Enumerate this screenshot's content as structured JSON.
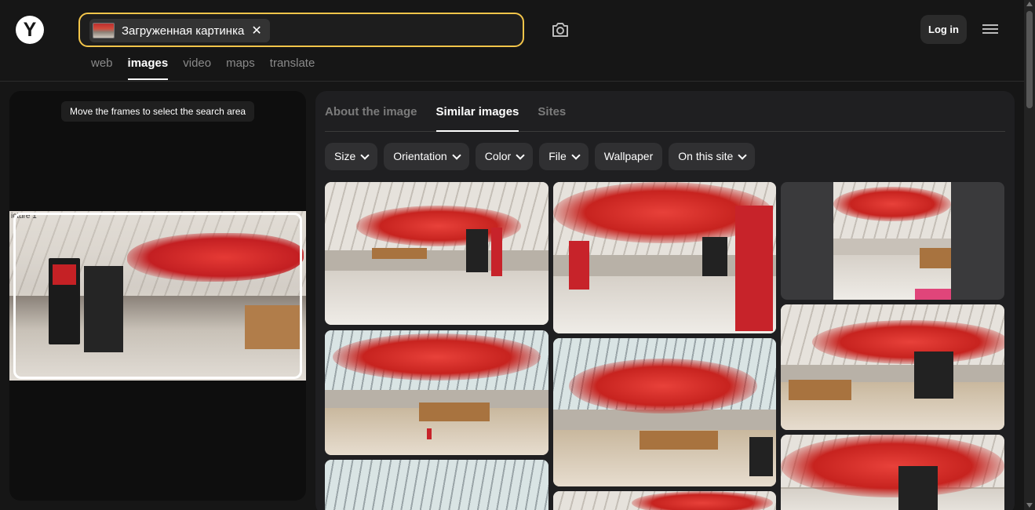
{
  "header": {
    "logo_letter": "Y",
    "search": {
      "chip_label": "Загруженная картинка",
      "close_glyph": "✕"
    },
    "camera_icon": "camera-search-icon",
    "login_label": "Log in",
    "menu_icon": "hamburger-menu-icon",
    "nav": [
      {
        "label": "web",
        "active": false
      },
      {
        "label": "images",
        "active": true
      },
      {
        "label": "video",
        "active": false
      },
      {
        "label": "maps",
        "active": false
      },
      {
        "label": "translate",
        "active": false
      }
    ]
  },
  "left_panel": {
    "hint": "Move the frames to select the search area",
    "image_label": "icture 1"
  },
  "right_panel": {
    "tabs": [
      {
        "label": "About the image",
        "active": false
      },
      {
        "label": "Similar images",
        "active": true
      },
      {
        "label": "Sites",
        "active": false
      }
    ],
    "filters": [
      {
        "label": "Size",
        "has_dropdown": true
      },
      {
        "label": "Orientation",
        "has_dropdown": true
      },
      {
        "label": "Color",
        "has_dropdown": true
      },
      {
        "label": "File",
        "has_dropdown": true
      },
      {
        "label": "Wallpaper",
        "has_dropdown": false
      },
      {
        "label": "On this site",
        "has_dropdown": true
      }
    ],
    "results_count_visible": 9
  },
  "colors": {
    "background": "#161616",
    "panel": "#1f1f21",
    "search_border": "#f3c54a",
    "art_red": "#c7231f"
  }
}
